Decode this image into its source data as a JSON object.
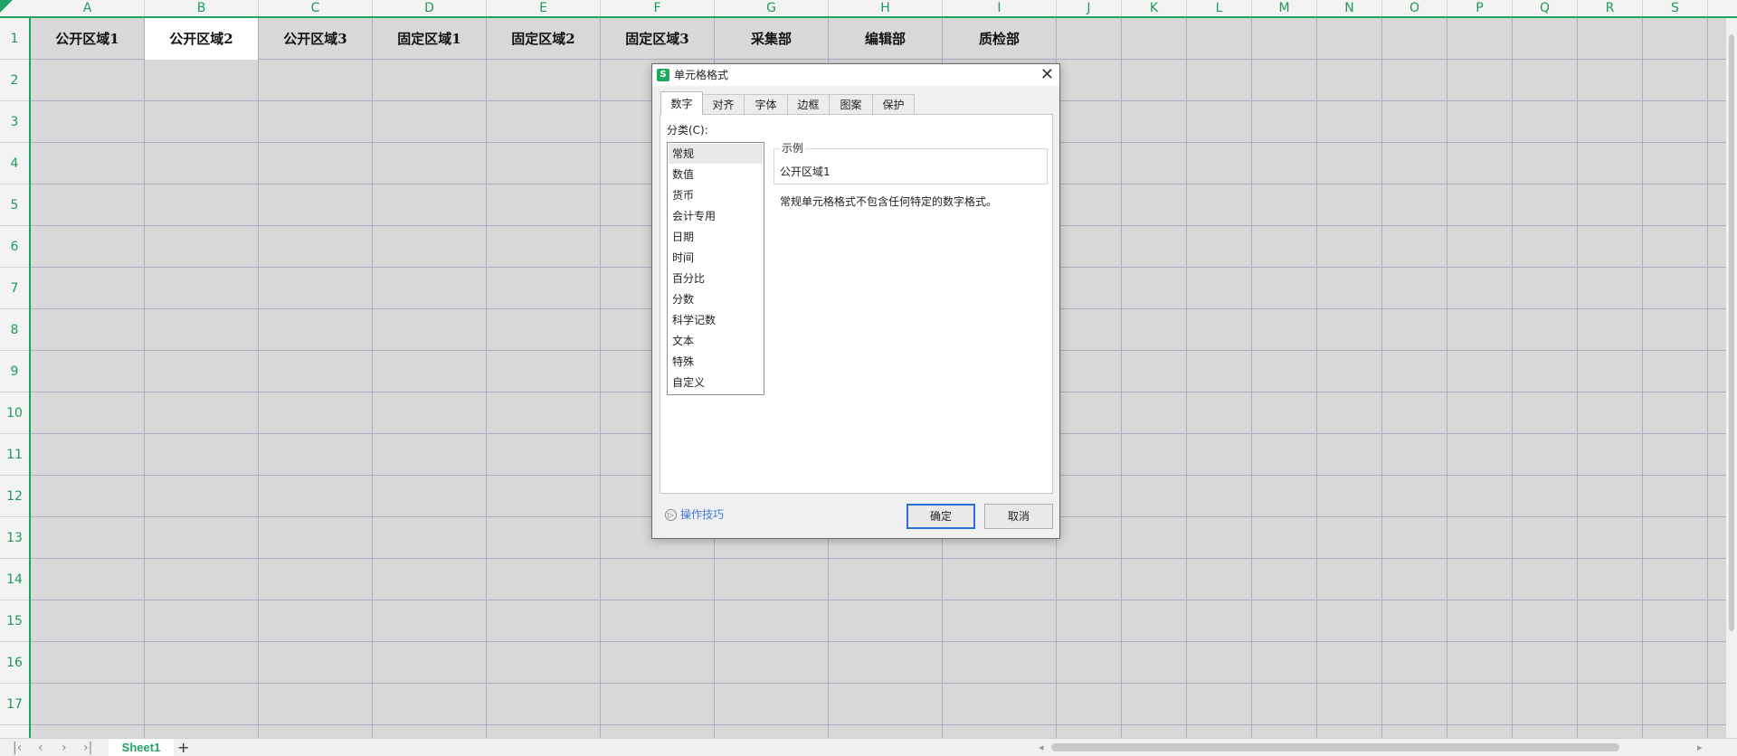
{
  "sheet": {
    "columns": [
      "A",
      "B",
      "C",
      "D",
      "E",
      "F",
      "G",
      "H",
      "I",
      "J",
      "K",
      "L",
      "M",
      "N",
      "O",
      "P",
      "Q",
      "R",
      "S"
    ],
    "rows": [
      "1",
      "2",
      "3",
      "4",
      "5",
      "6",
      "7",
      "8",
      "9",
      "10",
      "11",
      "12",
      "13",
      "14",
      "15",
      "16",
      "17"
    ],
    "row1_cells": [
      "公开区域1",
      "公开区域2",
      "公开区域3",
      "固定区域1",
      "固定区域2",
      "固定区域3",
      "采集部",
      "编辑部",
      "质检部"
    ],
    "selected_cell": "B1"
  },
  "sheet_bar": {
    "tab_label": "Sheet1",
    "add_label": "+",
    "nav": [
      "|‹",
      "‹",
      "›",
      "›|"
    ]
  },
  "dialog": {
    "title": "单元格格式",
    "icon_letter": "S",
    "close_label": "✕",
    "tabs": [
      "数字",
      "对齐",
      "字体",
      "边框",
      "图案",
      "保护"
    ],
    "active_tab": "数字",
    "category_label": "分类(C):",
    "categories": [
      "常规",
      "数值",
      "货币",
      "会计专用",
      "日期",
      "时间",
      "百分比",
      "分数",
      "科学记数",
      "文本",
      "特殊",
      "自定义"
    ],
    "selected_category": "常规",
    "sample_label": "示例",
    "sample_value": "公开区域1",
    "description": "常规单元格格式不包含任何特定的数字格式。",
    "tips_label": "操作技巧",
    "ok_label": "确定",
    "cancel_label": "取消"
  },
  "colors": {
    "accent": "#21a366",
    "link": "#3b7bd4",
    "ok_border": "#2d6fd6"
  }
}
